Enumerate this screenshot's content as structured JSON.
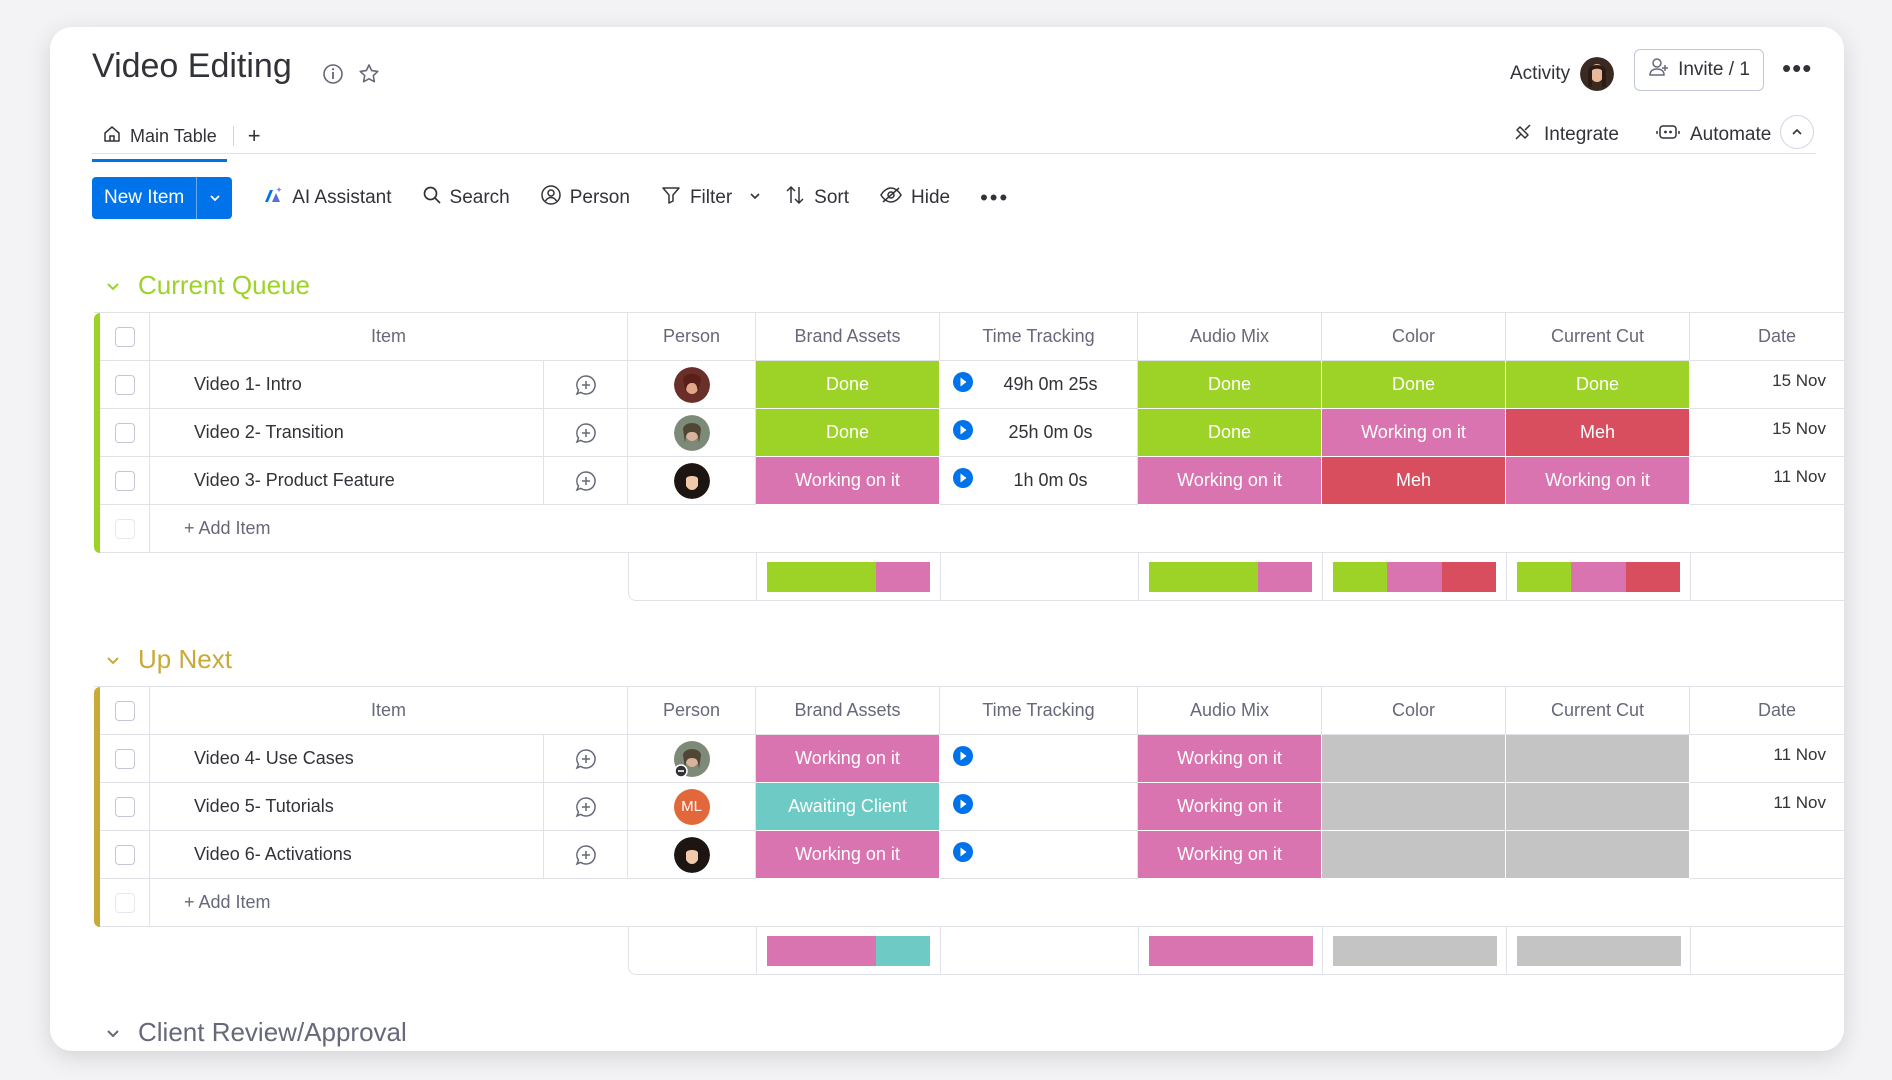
{
  "board": {
    "title": "Video Editing",
    "activity_label": "Activity",
    "invite_label": "Invite / 1",
    "tab_main": "Main Table",
    "tab_add": "+",
    "integrate_label": "Integrate",
    "automate_label": "Automate"
  },
  "toolbar": {
    "new_item": "New Item",
    "ai_assistant": "AI Assistant",
    "search": "Search",
    "person": "Person",
    "filter": "Filter",
    "sort": "Sort",
    "hide": "Hide"
  },
  "columns": {
    "item": "Item",
    "person": "Person",
    "brand_assets": "Brand Assets",
    "time_tracking": "Time Tracking",
    "audio_mix": "Audio Mix",
    "color": "Color",
    "current_cut": "Current Cut",
    "date": "Date"
  },
  "colors": {
    "done": "#9cd326",
    "working": "#d974b0",
    "meh": "#d94e5f",
    "awaiting": "#6ecac5",
    "empty": "#c4c4c4",
    "group1": "#9cd326",
    "group2": "#c9a938",
    "group3": "#676879",
    "primary": "#0073ea"
  },
  "groups": [
    {
      "title": "Current Queue",
      "add_item": "+ Add Item",
      "rows": [
        {
          "name": "Video 1- Intro",
          "brand": "Done",
          "time": "49h 0m 25s",
          "audio": "Done",
          "color": "Done",
          "cut": "Done",
          "date": "15 Nov"
        },
        {
          "name": "Video 2- Transition",
          "brand": "Done",
          "time": "25h 0m 0s",
          "audio": "Done",
          "color": "Working on it",
          "cut": "Meh",
          "date": "15 Nov"
        },
        {
          "name": "Video 3- Product Feature",
          "brand": "Working on it",
          "time": "1h 0m 0s",
          "audio": "Working on it",
          "color": "Meh",
          "cut": "Working on it",
          "date": "11 Nov"
        }
      ]
    },
    {
      "title": "Up Next",
      "add_item": "+ Add Item",
      "rows": [
        {
          "name": "Video 4- Use Cases",
          "brand": "Working on it",
          "time": "",
          "audio": "Working on it",
          "color": "",
          "cut": "",
          "date": "11 Nov"
        },
        {
          "name": "Video 5- Tutorials",
          "brand": "Awaiting Client",
          "time": "",
          "audio": "Working on it",
          "color": "",
          "cut": "",
          "date": "11 Nov",
          "avatar_initials": "ML"
        },
        {
          "name": "Video 6- Activations",
          "brand": "Working on it",
          "time": "",
          "audio": "Working on it",
          "color": "",
          "cut": "",
          "date": ""
        }
      ]
    },
    {
      "title": "Client Review/Approval"
    }
  ]
}
